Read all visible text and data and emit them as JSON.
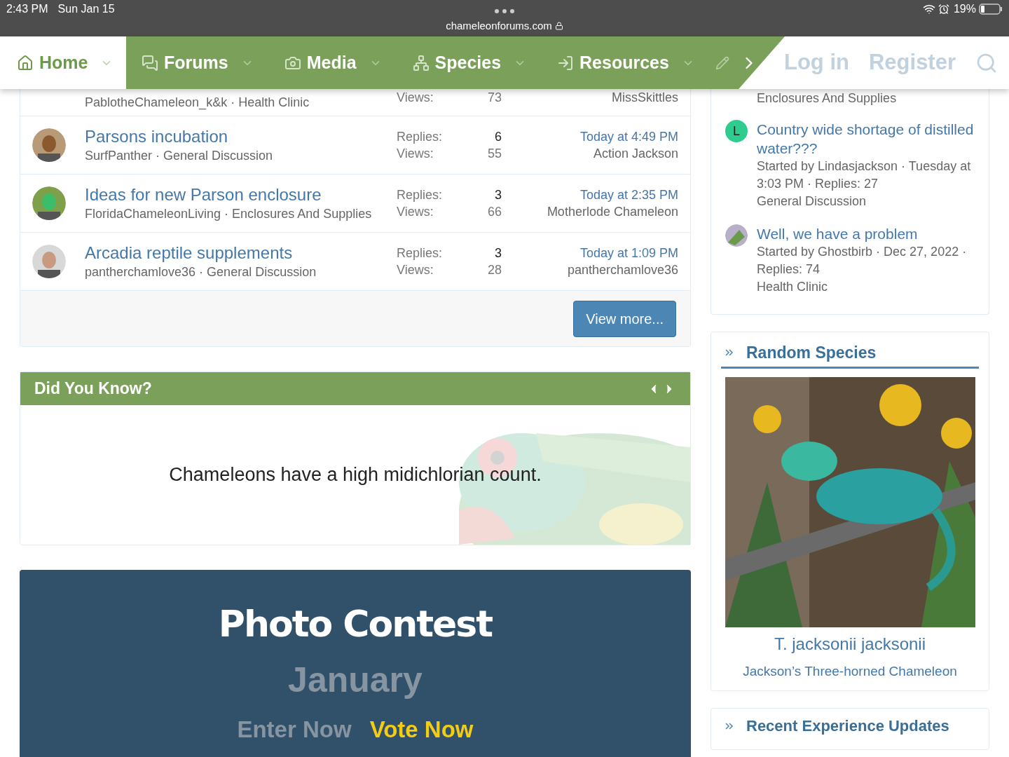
{
  "status_bar": {
    "time": "2:43 PM",
    "date": "Sun Jan 15",
    "url": "chameleonforums.com",
    "battery": "19%"
  },
  "nav": {
    "items": [
      {
        "label": "Home",
        "selected": true
      },
      {
        "label": "Forums",
        "selected": false
      },
      {
        "label": "Media",
        "selected": false
      },
      {
        "label": "Species",
        "selected": false
      },
      {
        "label": "Resources",
        "selected": false
      }
    ],
    "login": "Log in",
    "register": "Register"
  },
  "threads": {
    "cut_row": {
      "meta": "PablotheChameleon_k&k · Health Clinic",
      "views_label": "Views:",
      "views": "73",
      "last_user": "MissSkittles"
    },
    "rows": [
      {
        "title": "Parsons incubation",
        "meta": "SurfPanther · General Discussion",
        "replies_label": "Replies:",
        "replies": "6",
        "views_label": "Views:",
        "views": "55",
        "date": "Today at 4:49 PM",
        "last_user": "Action Jackson"
      },
      {
        "title": "Ideas for new Parson enclosure",
        "meta": "FloridaChameleonLiving · Enclosures And Supplies",
        "replies_label": "Replies:",
        "replies": "3",
        "views_label": "Views:",
        "views": "66",
        "date": "Today at 2:35 PM",
        "last_user": "Motherlode Chameleon"
      },
      {
        "title": "Arcadia reptile supplements",
        "meta": "pantherchamlove36 · General Discussion",
        "replies_label": "Replies:",
        "replies": "3",
        "views_label": "Views:",
        "views": "28",
        "date": "Today at 1:09 PM",
        "last_user": "pantherchamlove36"
      }
    ],
    "view_more": "View more..."
  },
  "did_you_know": {
    "title": "Did You Know?",
    "fact": "Chameleons have a high midichlorian count."
  },
  "photo_contest": {
    "title": "Photo Contest",
    "month": "January",
    "enter": "Enter Now",
    "vote": "Vote Now"
  },
  "sidebar": {
    "cut_line": "Enclosures And Supplies",
    "threads": [
      {
        "avatar_letter": "L",
        "color": "#2ecc8f",
        "title": "Country wide shortage of distilled water???",
        "meta": "Started by Lindasjackson · Tuesday at 3:03 PM · Replies: 27",
        "forum": "General Discussion"
      },
      {
        "title": "Well, we have a problem",
        "meta": "Started by Ghostbirb · Dec 27, 2022 · Replies: 74",
        "forum": "Health Clinic"
      }
    ],
    "random_species": {
      "title": "Random Species",
      "name": "T. jacksonii jacksonii",
      "common": "Jackson’s Three-horned Chameleon"
    },
    "recent_title": "Recent Experience Updates"
  }
}
